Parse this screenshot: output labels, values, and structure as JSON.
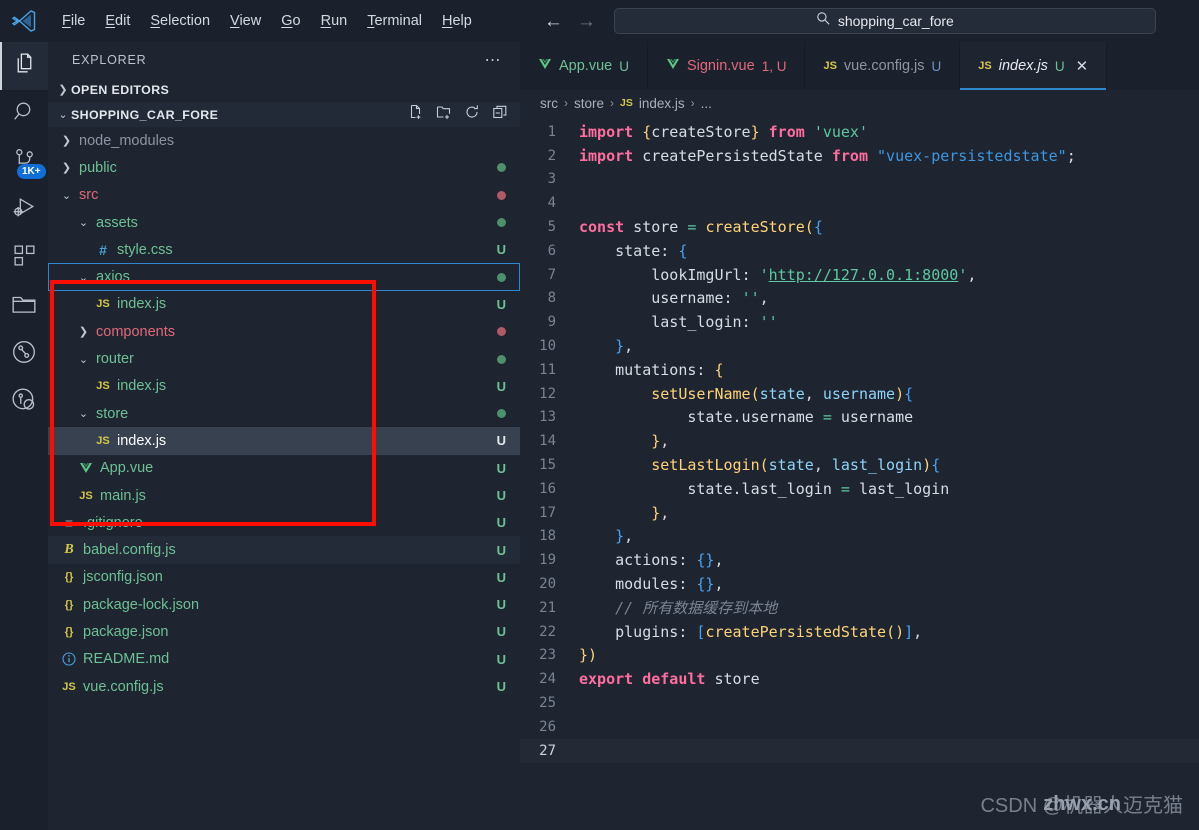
{
  "titlebar": {
    "logo_icon": "vscode-logo-icon",
    "menus": [
      {
        "label": "File",
        "accel": "F"
      },
      {
        "label": "Edit",
        "accel": "E"
      },
      {
        "label": "Selection",
        "accel": "S"
      },
      {
        "label": "View",
        "accel": "V"
      },
      {
        "label": "Go",
        "accel": "G"
      },
      {
        "label": "Run",
        "accel": "R"
      },
      {
        "label": "Terminal",
        "accel": "T"
      },
      {
        "label": "Help",
        "accel": "H"
      }
    ],
    "back_icon": "arrow-left-icon",
    "forward_icon": "arrow-right-icon",
    "search": {
      "icon": "search-icon",
      "value": "shopping_car_fore"
    }
  },
  "activitybar": {
    "items": [
      {
        "name": "explorer",
        "icon": "files-icon",
        "active": true,
        "badge": ""
      },
      {
        "name": "search",
        "icon": "search-icon",
        "active": false,
        "badge": ""
      },
      {
        "name": "source-control",
        "icon": "source-control-icon",
        "active": false,
        "badge": "1K+"
      },
      {
        "name": "run-and-debug",
        "icon": "run-debug-icon",
        "active": false,
        "badge": ""
      },
      {
        "name": "extensions",
        "icon": "extensions-icon",
        "active": false,
        "badge": ""
      },
      {
        "name": "explorer-alt",
        "icon": "folder-icon",
        "active": false,
        "badge": ""
      },
      {
        "name": "git-graph",
        "icon": "git-graph-icon",
        "active": false,
        "badge": ""
      },
      {
        "name": "git-lens",
        "icon": "gitlens-icon",
        "active": false,
        "badge": ""
      }
    ]
  },
  "sidebar": {
    "title": "EXPLORER",
    "more_icon": "ellipsis-icon",
    "sections": [
      {
        "label": "OPEN EDITORS",
        "expanded": false
      },
      {
        "label": "SHOPPING_CAR_FORE",
        "expanded": true
      }
    ],
    "folder_actions": [
      {
        "name": "new-file-icon"
      },
      {
        "name": "new-folder-icon"
      },
      {
        "name": "refresh-icon"
      },
      {
        "name": "collapse-all-icon"
      }
    ],
    "tree": [
      {
        "label": "node_modules",
        "type": "folder",
        "expanded": false,
        "indent": 1,
        "color": "#8d95a3",
        "badge": "",
        "dot": ""
      },
      {
        "label": "public",
        "type": "folder",
        "expanded": false,
        "indent": 1,
        "color": "#6ec195",
        "badge": "",
        "dot": "#4e8f6d"
      },
      {
        "label": "src",
        "type": "folder",
        "expanded": true,
        "indent": 1,
        "color": "#e0697b",
        "badge": "",
        "dot": "#b05a66"
      },
      {
        "label": "assets",
        "type": "folder",
        "expanded": true,
        "indent": 2,
        "color": "#6ec195",
        "badge": "",
        "dot": "#4e8f6d"
      },
      {
        "label": "style.css",
        "type": "css",
        "icon_text": "#",
        "icon_color": "#4aa3d8",
        "indent": 3,
        "color": "#6ec195",
        "badge": "U",
        "badge_color": "#6ec195",
        "dot": ""
      },
      {
        "label": "axios",
        "type": "folder",
        "expanded": true,
        "indent": 2,
        "color": "#6ec195",
        "badge": "",
        "dot": "#4e8f6d",
        "focused": true
      },
      {
        "label": "index.js",
        "type": "js",
        "icon_text": "JS",
        "icon_color": "#d4c84a",
        "indent": 3,
        "color": "#6ec195",
        "badge": "U",
        "badge_color": "#6ec195",
        "dot": ""
      },
      {
        "label": "components",
        "type": "folder",
        "expanded": false,
        "indent": 2,
        "color": "#e0697b",
        "badge": "",
        "dot": "#b05a66"
      },
      {
        "label": "router",
        "type": "folder",
        "expanded": true,
        "indent": 2,
        "color": "#6ec195",
        "badge": "",
        "dot": "#4e8f6d"
      },
      {
        "label": "index.js",
        "type": "js",
        "icon_text": "JS",
        "icon_color": "#d4c84a",
        "indent": 3,
        "color": "#6ec195",
        "badge": "U",
        "badge_color": "#6ec195",
        "dot": ""
      },
      {
        "label": "store",
        "type": "folder",
        "expanded": true,
        "indent": 2,
        "color": "#6ec195",
        "badge": "",
        "dot": "#4e8f6d"
      },
      {
        "label": "index.js",
        "type": "js",
        "icon_text": "JS",
        "icon_color": "#d4c84a",
        "indent": 3,
        "color": "#ffffff",
        "badge": "U",
        "badge_color": "#e3e7ed",
        "dot": "",
        "selected": true
      },
      {
        "label": "App.vue",
        "type": "vue",
        "icon_text": "V",
        "icon_color": "#5ec88a",
        "indent": 2,
        "color": "#6ec195",
        "badge": "U",
        "badge_color": "#6ec195",
        "dot": ""
      },
      {
        "label": "main.js",
        "type": "js",
        "icon_text": "JS",
        "icon_color": "#d4c84a",
        "indent": 2,
        "color": "#6ec195",
        "badge": "U",
        "badge_color": "#6ec195",
        "dot": ""
      },
      {
        "label": ".gitignore",
        "type": "git",
        "icon_text": "≡",
        "icon_color": "#9aa3b1",
        "indent": 1,
        "color": "#6ec195",
        "badge": "U",
        "badge_color": "#6ec195",
        "dot": ""
      },
      {
        "label": "babel.config.js",
        "type": "babel",
        "icon_text": "B",
        "icon_color": "#d4c84a",
        "indent": 1,
        "color": "#6ec195",
        "badge": "U",
        "badge_color": "#6ec195",
        "dot": "",
        "hover": true
      },
      {
        "label": "jsconfig.json",
        "type": "json",
        "icon_text": "{}",
        "icon_color": "#d4c84a",
        "indent": 1,
        "color": "#6ec195",
        "badge": "U",
        "badge_color": "#6ec195",
        "dot": ""
      },
      {
        "label": "package-lock.json",
        "type": "json",
        "icon_text": "{}",
        "icon_color": "#d4c84a",
        "indent": 1,
        "color": "#6ec195",
        "badge": "U",
        "badge_color": "#6ec195",
        "dot": ""
      },
      {
        "label": "package.json",
        "type": "json",
        "icon_text": "{}",
        "icon_color": "#d4c84a",
        "indent": 1,
        "color": "#6ec195",
        "badge": "U",
        "badge_color": "#6ec195",
        "dot": ""
      },
      {
        "label": "README.md",
        "type": "md",
        "icon_text": "i",
        "icon_color": "#4aa3d8",
        "indent": 1,
        "color": "#6ec195",
        "badge": "U",
        "badge_color": "#6ec195",
        "dot": ""
      },
      {
        "label": "vue.config.js",
        "type": "js",
        "icon_text": "JS",
        "icon_color": "#d4c84a",
        "indent": 1,
        "color": "#6ec195",
        "badge": "U",
        "badge_color": "#6ec195",
        "dot": ""
      }
    ],
    "annotation": {
      "color": "#ff0d00",
      "shape": "rectangle"
    }
  },
  "editor": {
    "tabs": [
      {
        "label": "App.vue",
        "icon_text": "V",
        "icon_color": "#5ec88a",
        "label_color": "#6ec195",
        "mark": "U",
        "mark_color": "#6ec195",
        "active": false,
        "closeable": false
      },
      {
        "label": "Signin.vue",
        "icon_text": "V",
        "icon_color": "#5ec88a",
        "label_color": "#e0697b",
        "mark": "1, U",
        "mark_color": "#e0697b",
        "active": false,
        "closeable": false
      },
      {
        "label": "vue.config.js",
        "icon_text": "JS",
        "icon_color": "#d4c84a",
        "label_color": "#8d95a3",
        "mark": "U",
        "mark_color": "#6b93c4",
        "active": false,
        "closeable": false
      },
      {
        "label": "index.js",
        "icon_text": "JS",
        "icon_color": "#d4c84a",
        "label_color": "#e6eaf0",
        "mark": "U",
        "mark_color": "#6ec195",
        "active": true,
        "closeable": true,
        "close_icon": "close-icon"
      }
    ],
    "breadcrumb": [
      {
        "text": "src",
        "icon": ""
      },
      {
        "text": "store",
        "icon": ""
      },
      {
        "text": "index.js",
        "icon": "JS"
      },
      {
        "text": "...",
        "icon": ""
      }
    ],
    "breadcrumb_separator": "›",
    "active_line": 27,
    "total_lines": 27,
    "code_lines": [
      {
        "n": 1,
        "tokens": [
          {
            "t": "import",
            "c": "t-kw"
          },
          {
            "t": " ",
            "c": "t-plain"
          },
          {
            "t": "{",
            "c": "t-brace"
          },
          {
            "t": "createStore",
            "c": "t-plain"
          },
          {
            "t": "}",
            "c": "t-brace"
          },
          {
            "t": " ",
            "c": "t-plain"
          },
          {
            "t": "from",
            "c": "t-kw"
          },
          {
            "t": " ",
            "c": "t-plain"
          },
          {
            "t": "'vuex'",
            "c": "t-str"
          }
        ]
      },
      {
        "n": 2,
        "tokens": [
          {
            "t": "import",
            "c": "t-kw"
          },
          {
            "t": " createPersistedState ",
            "c": "t-plain"
          },
          {
            "t": "from",
            "c": "t-kw"
          },
          {
            "t": " ",
            "c": "t-plain"
          },
          {
            "t": "\"vuex-persistedstate\"",
            "c": "t-str2"
          },
          {
            "t": ";",
            "c": "t-plain"
          }
        ]
      },
      {
        "n": 3,
        "tokens": []
      },
      {
        "n": 4,
        "tokens": []
      },
      {
        "n": 5,
        "tokens": [
          {
            "t": "const",
            "c": "t-kw"
          },
          {
            "t": " store ",
            "c": "t-plain"
          },
          {
            "t": "=",
            "c": "t-op"
          },
          {
            "t": " ",
            "c": "t-plain"
          },
          {
            "t": "createStore",
            "c": "t-fn"
          },
          {
            "t": "(",
            "c": "t-brace"
          },
          {
            "t": "{",
            "c": "t-brace-b"
          }
        ]
      },
      {
        "n": 6,
        "tokens": [
          {
            "t": "    state",
            "c": "t-plain"
          },
          {
            "t": ": ",
            "c": "t-plain"
          },
          {
            "t": "{",
            "c": "t-brace-b"
          }
        ]
      },
      {
        "n": 7,
        "tokens": [
          {
            "t": "        lookImgUrl",
            "c": "t-plain"
          },
          {
            "t": ": ",
            "c": "t-plain"
          },
          {
            "t": "'",
            "c": "t-str"
          },
          {
            "t": "http://127.0.0.1:8000",
            "c": "t-link"
          },
          {
            "t": "'",
            "c": "t-str"
          },
          {
            "t": ",",
            "c": "t-plain"
          }
        ]
      },
      {
        "n": 8,
        "tokens": [
          {
            "t": "        username",
            "c": "t-plain"
          },
          {
            "t": ": ",
            "c": "t-plain"
          },
          {
            "t": "''",
            "c": "t-str"
          },
          {
            "t": ",",
            "c": "t-plain"
          }
        ]
      },
      {
        "n": 9,
        "tokens": [
          {
            "t": "        last_login",
            "c": "t-plain"
          },
          {
            "t": ": ",
            "c": "t-plain"
          },
          {
            "t": "''",
            "c": "t-str"
          }
        ]
      },
      {
        "n": 10,
        "tokens": [
          {
            "t": "    ",
            "c": "t-plain"
          },
          {
            "t": "}",
            "c": "t-brace-b"
          },
          {
            "t": ",",
            "c": "t-plain"
          }
        ]
      },
      {
        "n": 11,
        "tokens": [
          {
            "t": "    mutations",
            "c": "t-plain"
          },
          {
            "t": ": ",
            "c": "t-plain"
          },
          {
            "t": "{",
            "c": "t-brace"
          }
        ]
      },
      {
        "n": 12,
        "tokens": [
          {
            "t": "        ",
            "c": "t-plain"
          },
          {
            "t": "setUserName",
            "c": "t-fn"
          },
          {
            "t": "(",
            "c": "t-brace"
          },
          {
            "t": "state",
            "c": "t-var"
          },
          {
            "t": ", ",
            "c": "t-plain"
          },
          {
            "t": "username",
            "c": "t-var"
          },
          {
            "t": ")",
            "c": "t-brace"
          },
          {
            "t": "{",
            "c": "t-brace-b"
          }
        ]
      },
      {
        "n": 13,
        "tokens": [
          {
            "t": "            state.username ",
            "c": "t-plain"
          },
          {
            "t": "=",
            "c": "t-op"
          },
          {
            "t": " username",
            "c": "t-plain"
          }
        ]
      },
      {
        "n": 14,
        "tokens": [
          {
            "t": "        ",
            "c": "t-plain"
          },
          {
            "t": "}",
            "c": "t-brace"
          },
          {
            "t": ",",
            "c": "t-plain"
          }
        ]
      },
      {
        "n": 15,
        "tokens": [
          {
            "t": "        ",
            "c": "t-plain"
          },
          {
            "t": "setLastLogin",
            "c": "t-fn"
          },
          {
            "t": "(",
            "c": "t-brace"
          },
          {
            "t": "state",
            "c": "t-var"
          },
          {
            "t": ", ",
            "c": "t-plain"
          },
          {
            "t": "last_login",
            "c": "t-var"
          },
          {
            "t": ")",
            "c": "t-brace"
          },
          {
            "t": "{",
            "c": "t-brace-b"
          }
        ]
      },
      {
        "n": 16,
        "tokens": [
          {
            "t": "            state.last_login ",
            "c": "t-plain"
          },
          {
            "t": "=",
            "c": "t-op"
          },
          {
            "t": " last_login",
            "c": "t-plain"
          }
        ]
      },
      {
        "n": 17,
        "tokens": [
          {
            "t": "        ",
            "c": "t-plain"
          },
          {
            "t": "}",
            "c": "t-brace"
          },
          {
            "t": ",",
            "c": "t-plain"
          }
        ]
      },
      {
        "n": 18,
        "tokens": [
          {
            "t": "    ",
            "c": "t-plain"
          },
          {
            "t": "}",
            "c": "t-brace-b"
          },
          {
            "t": ",",
            "c": "t-plain"
          }
        ]
      },
      {
        "n": 19,
        "tokens": [
          {
            "t": "    actions",
            "c": "t-plain"
          },
          {
            "t": ": ",
            "c": "t-plain"
          },
          {
            "t": "{}",
            "c": "t-brace-b"
          },
          {
            "t": ",",
            "c": "t-plain"
          }
        ]
      },
      {
        "n": 20,
        "tokens": [
          {
            "t": "    modules",
            "c": "t-plain"
          },
          {
            "t": ": ",
            "c": "t-plain"
          },
          {
            "t": "{}",
            "c": "t-brace-b"
          },
          {
            "t": ",",
            "c": "t-plain"
          }
        ]
      },
      {
        "n": 21,
        "tokens": [
          {
            "t": "    // 所有数据缓存到本地",
            "c": "t-cmt"
          }
        ]
      },
      {
        "n": 22,
        "tokens": [
          {
            "t": "    plugins",
            "c": "t-plain"
          },
          {
            "t": ": ",
            "c": "t-plain"
          },
          {
            "t": "[",
            "c": "t-brace-b"
          },
          {
            "t": "createPersistedState",
            "c": "t-fn"
          },
          {
            "t": "()",
            "c": "t-brace"
          },
          {
            "t": "]",
            "c": "t-brace-b"
          },
          {
            "t": ",",
            "c": "t-plain"
          }
        ]
      },
      {
        "n": 23,
        "tokens": [
          {
            "t": "}",
            "c": "t-brace"
          },
          {
            "t": ")",
            "c": "t-brace"
          }
        ]
      },
      {
        "n": 24,
        "tokens": [
          {
            "t": "export",
            "c": "t-kw"
          },
          {
            "t": " ",
            "c": "t-plain"
          },
          {
            "t": "default",
            "c": "t-kw"
          },
          {
            "t": " store",
            "c": "t-plain"
          }
        ]
      },
      {
        "n": 25,
        "tokens": []
      },
      {
        "n": 26,
        "tokens": []
      },
      {
        "n": 27,
        "tokens": []
      }
    ]
  },
  "watermarks": {
    "primary": "CSDN @机器人迈克猫",
    "secondary": "zhwx.cn"
  }
}
